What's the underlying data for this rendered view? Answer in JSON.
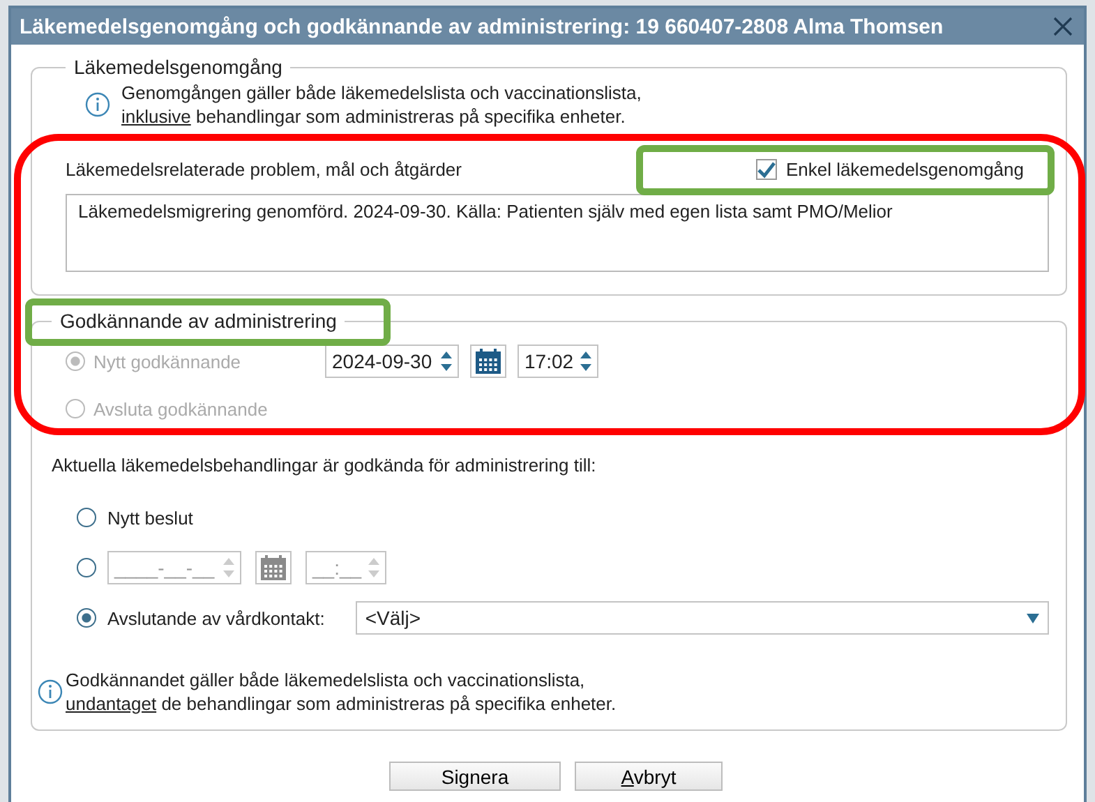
{
  "window": {
    "title": "Läkemedelsgenomgång och godkännande av administrering: 19 660407-2808 Alma Thomsen"
  },
  "review": {
    "legend": "Läkemedelsgenomgång",
    "info": {
      "line1": "Genomgången gäller både läkemedelslista och vaccinationslista,",
      "underlined": "inklusive",
      "rest": "behandlingar som administreras på specifika enheter."
    },
    "problems_label": "Läkemedelsrelaterade problem, mål och åtgärder",
    "simple_review": {
      "label": "Enkel läkemedelsgenomgång",
      "checked": true
    },
    "notes": "Läkemedelsmigrering genomförd. 2024-09-30. Källa: Patienten själv med egen lista samt PMO/Melior"
  },
  "approval": {
    "legend": "Godkännande av administrering",
    "options": [
      {
        "label": "Nytt godkännande",
        "selected": true,
        "disabled": true,
        "date": "2024-09-30",
        "time": "17:02"
      },
      {
        "label": "Avsluta godkännande",
        "selected": false,
        "disabled": true
      }
    ]
  },
  "validity": {
    "prompt": "Aktuella läkemedelsbehandlingar är godkända för administrering till:",
    "options": [
      {
        "kind": "text",
        "label": "Nytt beslut",
        "selected": false
      },
      {
        "kind": "datetime",
        "date_placeholder": "____-__-__",
        "time_placeholder": "__:__",
        "selected": false
      },
      {
        "kind": "dropdown",
        "label": "Avslutande av vårdkontakt:",
        "value": "<Välj>",
        "selected": true
      }
    ],
    "info": {
      "line1": "Godkännandet gäller både läkemedelslista och vaccinationslista,",
      "underlined": "undantaget",
      "rest": "de behandlingar som administreras på specifika enheter."
    }
  },
  "buttons": [
    {
      "label": "Signera",
      "mnemonic": false
    },
    {
      "label": "Avbryt",
      "mnemonic": true
    }
  ],
  "annotations": [
    {
      "kind": "ellipse",
      "color": "#ff0000"
    },
    {
      "kind": "box",
      "color": "#70ad47"
    },
    {
      "kind": "box",
      "color": "#70ad47"
    }
  ]
}
